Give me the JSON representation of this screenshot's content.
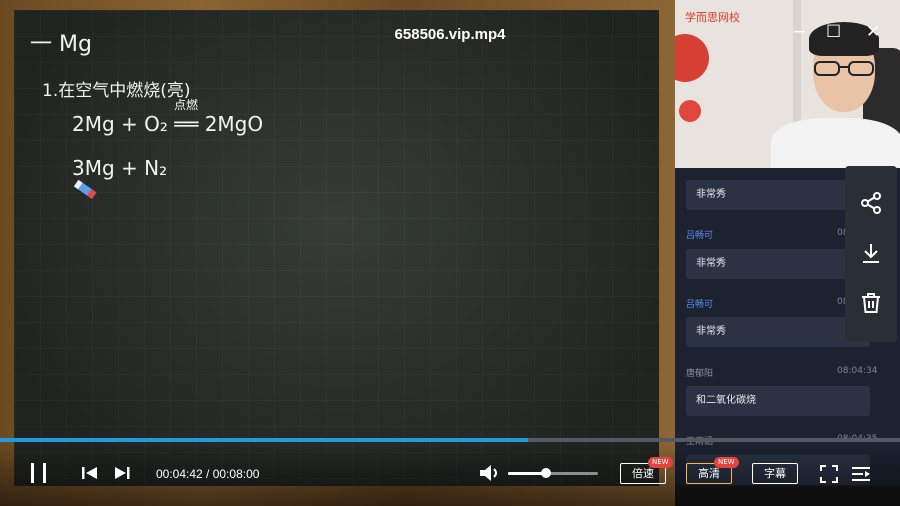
{
  "video_title": "658506.vip.mp4",
  "board": {
    "line_heading": "一 Mg",
    "line_1": "1.在空气中燃烧(亮)",
    "line_2": "2Mg + O₂ ══ 2MgO",
    "line_2_condition": "点燃",
    "line_3": "3Mg + N₂"
  },
  "camera": {
    "logo_text": "学而思网校"
  },
  "window_controls": {
    "minimize": "−",
    "maximize": "☐",
    "close": "✕"
  },
  "chat": {
    "messages": [
      {
        "name": "",
        "time": "",
        "text": "非常秀"
      },
      {
        "name": "吕畅可",
        "time": "08:04:1",
        "text": "非常秀"
      },
      {
        "name": "吕畅可",
        "time": "08:04:2",
        "text": "非常秀"
      },
      {
        "name": "唐郁阳",
        "time": "08:04:34",
        "text": "和二氧化碳烧"
      },
      {
        "name": "王雨涵",
        "time": "08:04:35",
        "text": ""
      }
    ],
    "name_colors": [
      "#5b8ff2",
      "#5b8ff2",
      "#8a93a3",
      "#8a93a3"
    ]
  },
  "share_panel": {
    "icons": [
      "share-icon",
      "download-icon",
      "trash-icon"
    ]
  },
  "player": {
    "current_time": "00:04:42",
    "separator": " / ",
    "total_time": "00:08:00",
    "progress": 0.587,
    "volume": 0.42,
    "speed_label": "倍速",
    "quality_label": "高清",
    "subtitle_label": "字幕",
    "new_tag": "NEW",
    "accent_color": "#1f9bde",
    "quality_color": "#f5b849"
  }
}
